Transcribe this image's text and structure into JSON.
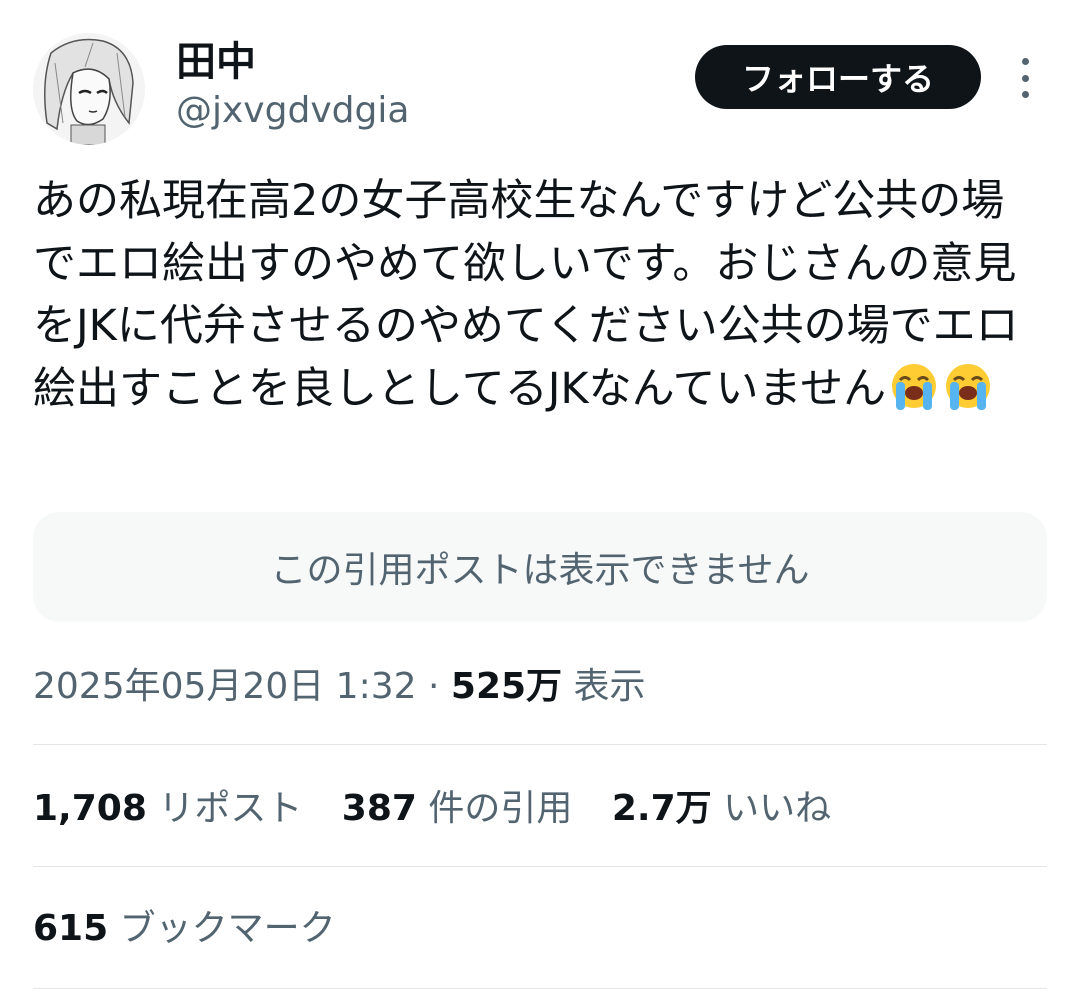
{
  "user": {
    "display_name": "田中",
    "handle": "@jxvgdvdgia"
  },
  "header": {
    "follow_label": "フォローする",
    "more_icon": "more-vertical-icon"
  },
  "tweet": {
    "text": "あの私現在高2の女子高校生なんですけど公共の場でエロ絵出すのやめて欲しいです。おじさんの意見をJKに代弁させるのやめてください公共の場でエロ絵出すことを良しとしてるJKなんていません",
    "emojis": [
      "loudly-crying-face-emoji",
      "loudly-crying-face-emoji"
    ]
  },
  "quote": {
    "unavailable_text": "この引用ポストは表示できません"
  },
  "meta": {
    "timestamp": "2025年05月20日 1:32",
    "separator": "·",
    "views_count": "525万",
    "views_label": "表示"
  },
  "stats": {
    "reposts": {
      "count": "1,708",
      "label": "リポスト"
    },
    "quotes": {
      "count": "387",
      "label": "件の引用"
    },
    "likes": {
      "count": "2.7万",
      "label": "いいね"
    },
    "bookmarks": {
      "count": "615",
      "label": "ブックマーク"
    }
  },
  "colors": {
    "text_primary": "#0f1419",
    "text_secondary": "#536471",
    "follow_bg": "#0f1419",
    "quote_bg": "#f7f9f9",
    "divider": "#e3e7ea"
  }
}
